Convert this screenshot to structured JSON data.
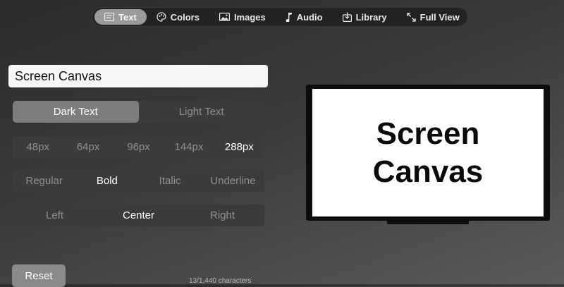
{
  "nav": {
    "items": [
      {
        "label": "Text",
        "icon": "text-icon",
        "active": true
      },
      {
        "label": "Colors",
        "icon": "palette-icon"
      },
      {
        "label": "Images",
        "icon": "image-icon"
      },
      {
        "label": "Audio",
        "icon": "music-note-icon"
      },
      {
        "label": "Library",
        "icon": "library-icon"
      },
      {
        "label": "Full View",
        "icon": "expand-icon"
      }
    ]
  },
  "text_input": {
    "value": "Screen Canvas"
  },
  "color_options": {
    "dark": "Dark Text",
    "light": "Light Text",
    "selected": "Dark Text"
  },
  "size_options": {
    "s48": "48px",
    "s64": "64px",
    "s96": "96px",
    "s144": "144px",
    "s288": "288px",
    "selected": "288px"
  },
  "style_options": {
    "regular": "Regular",
    "bold": "Bold",
    "italic": "Italic",
    "underline": "Underline",
    "selected": "Bold"
  },
  "align_options": {
    "left": "Left",
    "center": "Center",
    "right": "Right",
    "selected": "Center"
  },
  "reset_label": "Reset",
  "char_count": "13/1,440 characters",
  "preview": {
    "text": "Screen\nCanvas",
    "background": "#ffffff",
    "text_color": "#0b0b0b"
  },
  "colors": {
    "selected_segment": "#7d7d7d",
    "nav_active": "#9a9a9a"
  }
}
